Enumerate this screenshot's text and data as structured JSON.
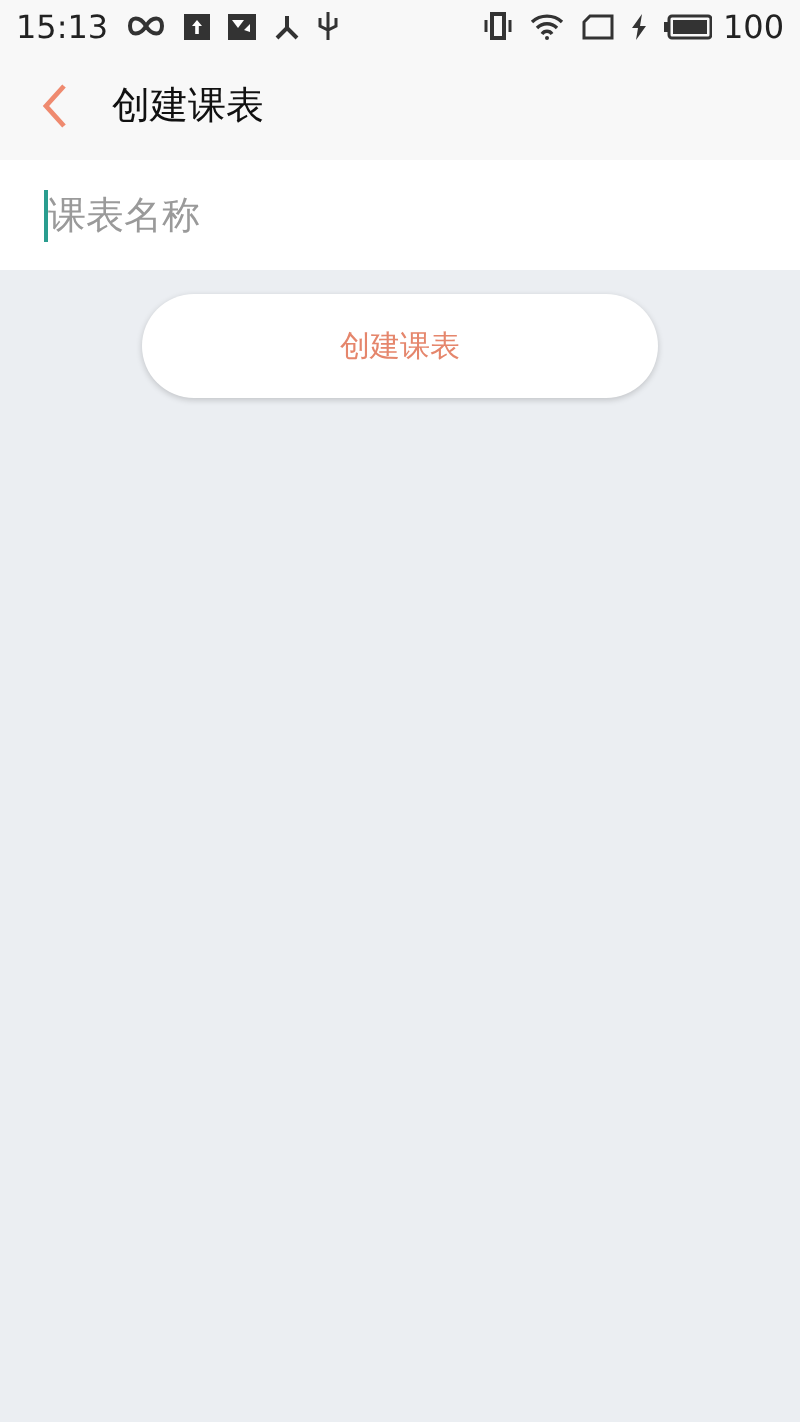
{
  "status_bar": {
    "time": "15:13",
    "battery": "100"
  },
  "header": {
    "title": "创建课表"
  },
  "form": {
    "name_field": {
      "placeholder": "课表名称"
    }
  },
  "buttons": [
    "创建课表"
  ]
}
